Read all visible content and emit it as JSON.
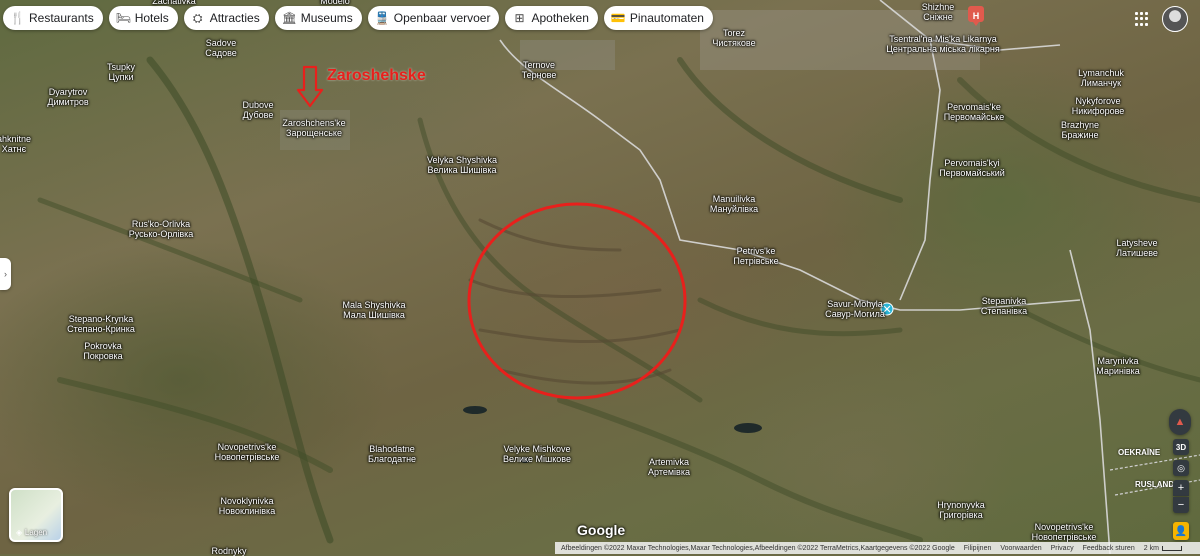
{
  "chips": [
    {
      "icon": "fork-knife-icon",
      "glyph": "🍴",
      "label": "Restaurants"
    },
    {
      "icon": "bed-icon",
      "glyph": "🛏",
      "label": "Hotels"
    },
    {
      "icon": "camera-icon",
      "glyph": "⛭",
      "label": "Attracties"
    },
    {
      "icon": "museum-icon",
      "glyph": "🏛",
      "label": "Museums"
    },
    {
      "icon": "train-icon",
      "glyph": "🚆",
      "label": "Openbaar vervoer"
    },
    {
      "icon": "pharmacy-icon",
      "glyph": "⊞",
      "label": "Apotheken"
    },
    {
      "icon": "atm-icon",
      "glyph": "💳",
      "label": "Pinautomaten"
    }
  ],
  "annotation": {
    "label": "Zaroshehske",
    "color": "#e8201c"
  },
  "places": [
    {
      "name": "Zachativka",
      "alt": ""
    },
    {
      "name": "Modelo",
      "alt": ""
    },
    {
      "name": "Sadove",
      "alt": "Садове"
    },
    {
      "name": "Tsupky",
      "alt": "Цупки"
    },
    {
      "name": "Dyarytrov",
      "alt": "Димитров"
    },
    {
      "name": "Dubove",
      "alt": "Дубове"
    },
    {
      "name": "Zaroshchens'ke",
      "alt": "Зарощенське"
    },
    {
      "name": "ahknitne",
      "alt": "Хатнє"
    },
    {
      "name": "Velyka Shyshivka",
      "alt": "Велика Шишівка"
    },
    {
      "name": "Rus'ko-Orlivka",
      "alt": "Русько-Орлівка"
    },
    {
      "name": "Mala Shyshivka",
      "alt": "Мала Шишівка"
    },
    {
      "name": "Stepano-Krynka",
      "alt": "Степано-Кринка"
    },
    {
      "name": "Pokrovka",
      "alt": "Покровка"
    },
    {
      "name": "Novopetrivs'ke",
      "alt": "Новопетрівське"
    },
    {
      "name": "Blahodatne",
      "alt": "Благодатне"
    },
    {
      "name": "Novoklynivka",
      "alt": "Новоклинівка"
    },
    {
      "name": "Rodnyky",
      "alt": ""
    },
    {
      "name": "Velyke Mishkove",
      "alt": "Велике Мішкове"
    },
    {
      "name": "Artemivka",
      "alt": "Артемівка"
    },
    {
      "name": "Ternove",
      "alt": "Тернове"
    },
    {
      "name": "Torez",
      "alt": "Чистякове"
    },
    {
      "name": "Shizhne",
      "alt": "Сніжне"
    },
    {
      "name": "Tsentral'na Mis'ka Likarnya",
      "alt": "Центральна міська лікарня"
    },
    {
      "name": "Lymanchuk",
      "alt": "Лиманчук"
    },
    {
      "name": "Nykyforove",
      "alt": "Никифорове"
    },
    {
      "name": "Brazhyne",
      "alt": "Бражине"
    },
    {
      "name": "Pervomais'ke",
      "alt": "Первомайське"
    },
    {
      "name": "Pervomais'kyi",
      "alt": "Первомайський"
    },
    {
      "name": "Manuilivka",
      "alt": "Мануйлівка"
    },
    {
      "name": "Petrivs'ke",
      "alt": "Петрівське"
    },
    {
      "name": "Savur-Mohyla",
      "alt": "Савур-Могила"
    },
    {
      "name": "Stepanivka",
      "alt": "Степанівка"
    },
    {
      "name": "Latysheve",
      "alt": "Латишеве"
    },
    {
      "name": "Marynivka",
      "alt": "Маринівка"
    },
    {
      "name": "Hrynonyvka",
      "alt": "Григорівка"
    },
    {
      "name": "Novopetrivs'ke",
      "alt": "Новопетрівське"
    }
  ],
  "border_labels": [
    "OEKRAÏNE",
    "RUSLAND"
  ],
  "layers": {
    "label": "Lagen"
  },
  "logo": "Google",
  "footer": {
    "attribution": "Afbeeldingen ©2022 Maxar Technologies,Maxar Technologies,Afbeeldingen ©2022 TerraMetrics,Kaartgegevens ©2022 Google",
    "links": [
      "Filipijnen",
      "Voorwaarden",
      "Privacy",
      "Feedback sturen"
    ],
    "scale": "2 km"
  },
  "controls": {
    "view3d": "3D",
    "zoom_in": "+",
    "zoom_out": "−"
  },
  "colors": {
    "circle": "#e8201c",
    "roads": "#d9d9d9",
    "marker": "#29b6d8",
    "hospital": "#e05a4d"
  }
}
